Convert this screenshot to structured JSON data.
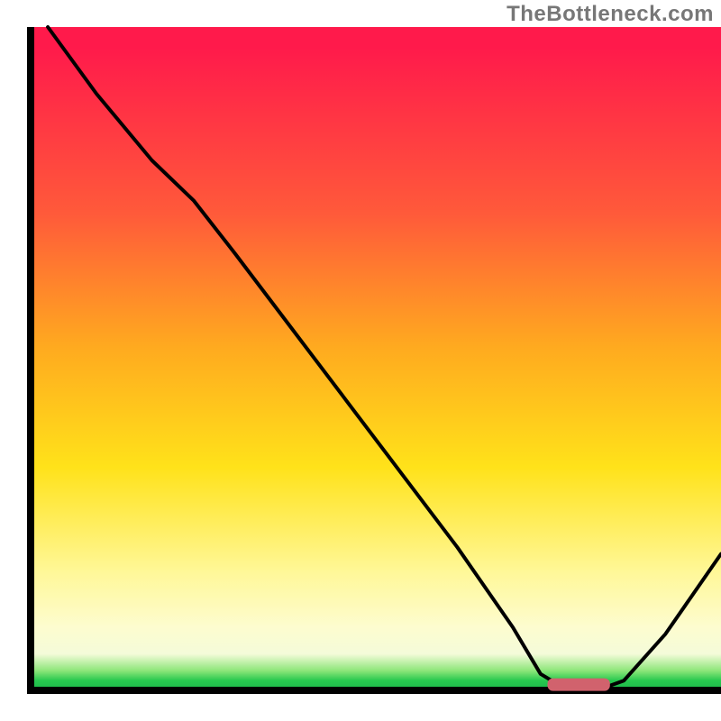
{
  "watermark": "TheBottleneck.com",
  "colors": {
    "curve": "#000000",
    "marker": "#d1626d",
    "gradient_top": "#ff1a4b",
    "gradient_bottom": "#18b14a"
  },
  "chart_data": {
    "type": "line",
    "title": "",
    "xlabel": "",
    "ylabel": "",
    "xlim": [
      0,
      100
    ],
    "ylim": [
      0,
      100
    ],
    "grid": false,
    "legend": false,
    "series": [
      {
        "name": "bottleneck-curve",
        "x": [
          3,
          10,
          18,
          24,
          30,
          38,
          46,
          54,
          62,
          70,
          74,
          78,
          82,
          86,
          92,
          100
        ],
        "y": [
          100,
          90,
          80,
          74,
          66,
          55,
          44,
          33,
          22,
          10,
          3,
          0.5,
          0.5,
          2,
          9,
          21
        ]
      }
    ],
    "marker": {
      "name": "optimal-range",
      "x_range": [
        75,
        84
      ],
      "y": 1.4
    },
    "annotations": []
  }
}
